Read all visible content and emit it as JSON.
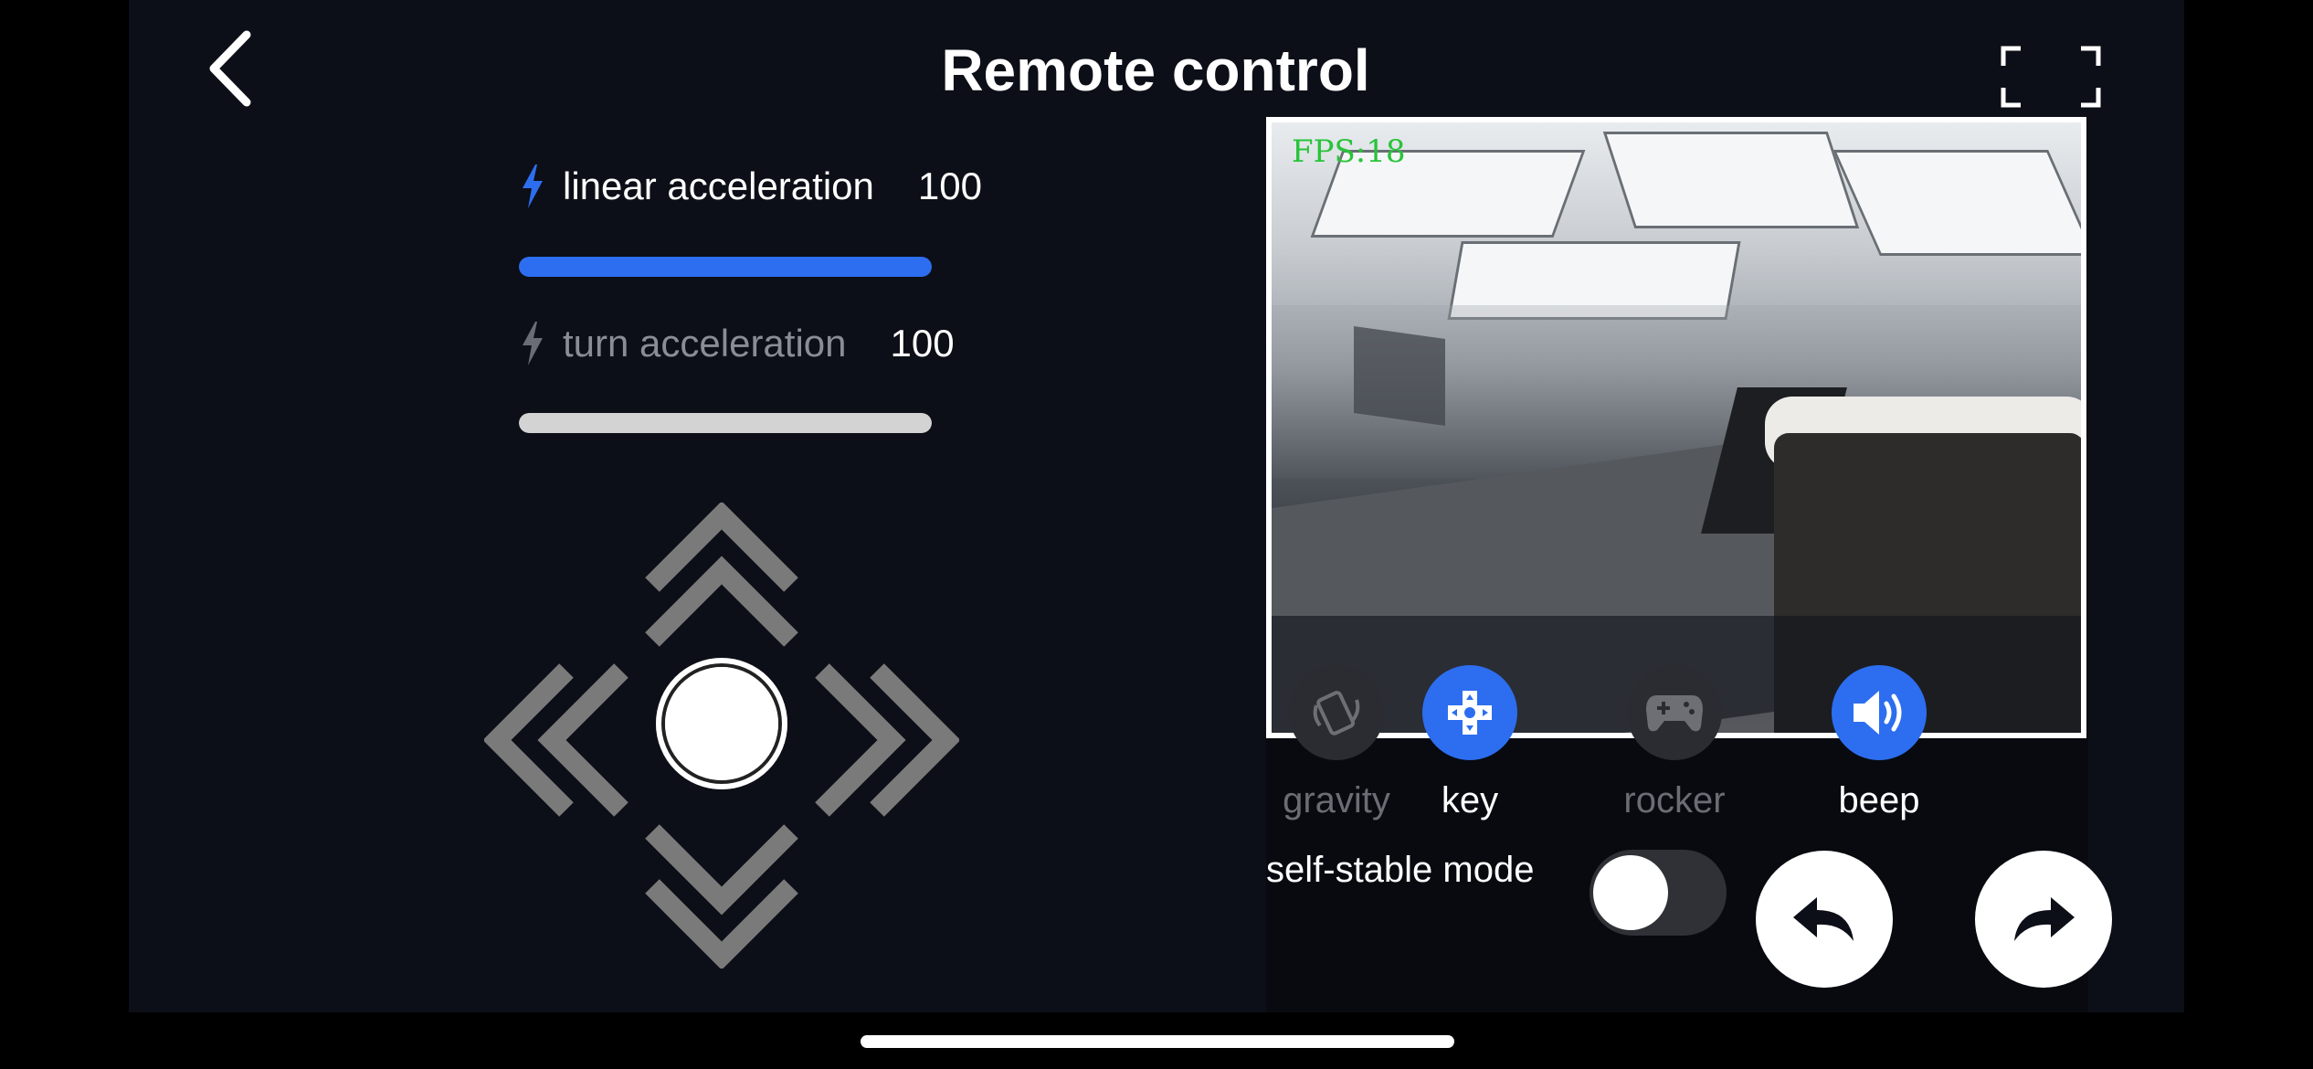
{
  "header": {
    "title": "Remote control"
  },
  "params": {
    "linear": {
      "label": "linear acceleration",
      "value": "100",
      "level": 1.0
    },
    "turn": {
      "label": "turn acceleration",
      "value": "100",
      "level": 1.0
    }
  },
  "camera": {
    "fps_text": "FPS:18"
  },
  "modes": [
    {
      "label": "gravity",
      "active": false
    },
    {
      "label": "key",
      "active": true
    },
    {
      "label": "rocker",
      "active": false
    },
    {
      "label": "beep",
      "active": true
    }
  ],
  "stable_mode": {
    "label": "self-stable mode",
    "enabled": false
  },
  "colors": {
    "accent": "#2d6ef0",
    "inactive": "#6a6d73",
    "background": "#0c0f17",
    "fps_green": "#29c33a"
  },
  "icons": {
    "back": "chevron-left-icon",
    "fullscreen": "fullscreen-icon",
    "bolt": "bolt-icon",
    "undo": "undo-arrow-icon",
    "redo": "redo-arrow-icon"
  }
}
